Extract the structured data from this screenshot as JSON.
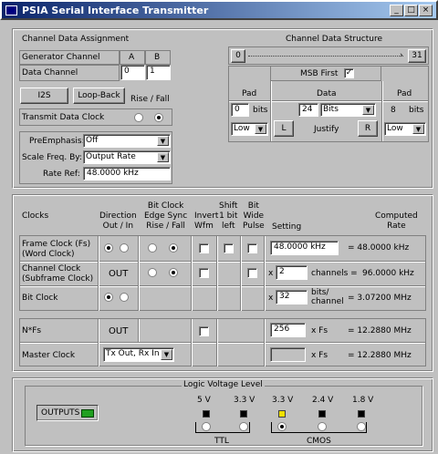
{
  "window": {
    "title": "PSIA Serial Interface Transmitter",
    "min": "_",
    "max": "□",
    "close": "×"
  },
  "assign": {
    "title": "Channel Data Assignment",
    "gen_channel": "Generator Channel",
    "col_a": "A",
    "col_b": "B",
    "data_channel": "Data Channel",
    "data_a": "0",
    "data_b": "1",
    "i2s": "I2S",
    "loopback": "Loop-Back",
    "rise_fall": "Rise / Fall",
    "transmit_clock": "Transmit Data Clock",
    "preemph_label": "PreEmphasis:",
    "preemph_value": "Off",
    "scale_label": "Scale Freq. By:",
    "scale_value": "Output Rate",
    "rateref_label": "Rate Ref:",
    "rateref_value": "48.0000 kHz"
  },
  "structure": {
    "title": "Channel Data Structure",
    "bit_lo": "0",
    "bit_hi": "31",
    "msb_first": "MSB First",
    "msb_checked": true,
    "pad": "Pad",
    "data": "Data",
    "pad2": "Pad",
    "pad_left_value": "0",
    "bits": "bits",
    "data_bits_value": "24",
    "data_bits_unit": "Bits",
    "pad_right_value": "8",
    "pad_right_unit": "bits",
    "low_left": "Low",
    "justify_l": "L",
    "justify": "Justify",
    "justify_r": "R",
    "low_right": "Low"
  },
  "clocks": {
    "h_clocks": "Clocks",
    "h_direction": "Direction\nOut / In",
    "h_bitclock": "Bit Clock\nEdge Sync\nRise / Fall",
    "h_invert": "Invert\nWfm",
    "h_shift": "Shift\n1 bit\nleft",
    "h_bitwide": "Bit\nWide\nPulse",
    "h_setting": "Setting",
    "h_computed": "Computed\nRate",
    "frame_label": "Frame Clock (Fs)\n(Word Clock)",
    "frame_setting": "48.0000 kHz",
    "frame_rate": "= 48.0000 kHz",
    "channel_label": "Channel Clock\n(Subframe Clock)",
    "channel_dir": "OUT",
    "channel_x": "x",
    "channel_setting": "2",
    "channel_unit": "channels =",
    "channel_rate": "96.0000 kHz",
    "bit_label": "Bit Clock",
    "bit_x": "x",
    "bit_setting": "32",
    "bit_unit": "bits/\nchannel",
    "bit_rate": "= 3.07200 MHz",
    "nfs_label": "N*Fs",
    "nfs_dir": "OUT",
    "nfs_setting": "256",
    "nfs_unit": "x Fs",
    "nfs_rate": "= 12.2880 MHz",
    "master_label": "Master Clock",
    "master_dir": "Tx Out, Rx In",
    "master_unit": "x Fs",
    "master_rate": "= 12.2880 MHz"
  },
  "logic": {
    "title": "Logic Voltage Level",
    "outputs": "OUTPUTS",
    "v1": "5 V",
    "v2": "3.3 V",
    "v3": "3.3 V",
    "v4": "2.4 V",
    "v5": "1.8 V",
    "ttl": "TTL",
    "cmos": "CMOS",
    "selected": "3.3 V CMOS"
  },
  "colors": {
    "title_start": "#0a246a",
    "title_end": "#a6caf0",
    "led_active": "#f0e000",
    "outputs_led": "#20a020"
  }
}
